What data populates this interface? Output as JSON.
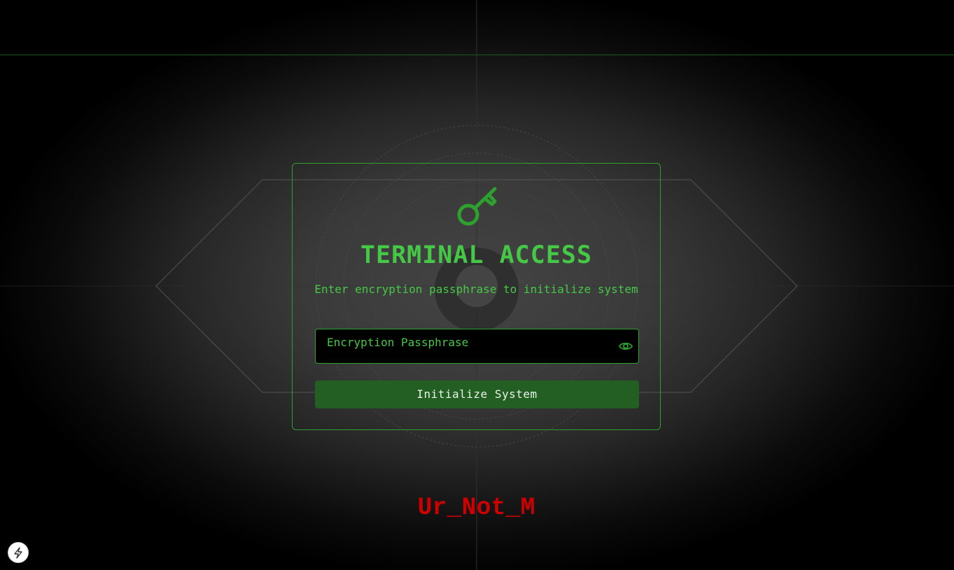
{
  "login_card": {
    "title": "TERMINAL ACCESS",
    "subtitle": "Enter encryption passphrase to initialize system",
    "passphrase_field": {
      "placeholder": "Encryption Passphrase",
      "value": "",
      "toggle_icon": "eye-icon"
    },
    "submit_label": "Initialize System",
    "header_icon": "key-icon"
  },
  "footer": {
    "signature": "Ur_Not_M"
  },
  "corner_widget": {
    "icon": "lightning-bolt-icon"
  },
  "colors": {
    "accent_green": "#45c845",
    "border_green": "#2ea02e",
    "button_green": "#235f23",
    "signature_red": "#cc0000",
    "background": "#000000"
  }
}
